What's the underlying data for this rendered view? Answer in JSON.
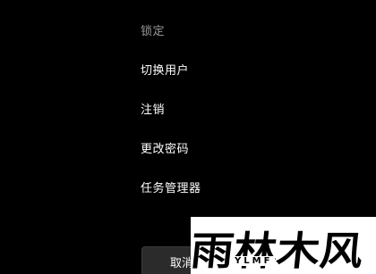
{
  "menu": {
    "items": [
      {
        "label": "锁定",
        "muted": true
      },
      {
        "label": "切换用户",
        "muted": false
      },
      {
        "label": "注销",
        "muted": false
      },
      {
        "label": "更改密码",
        "muted": false
      },
      {
        "label": "任务管理器",
        "muted": false
      }
    ]
  },
  "cancel_button": {
    "label": "取消"
  },
  "watermark": {
    "logo_text": "雨林木风",
    "sub_text": "YLMF"
  },
  "colors": {
    "background": "#000000",
    "text": "#ffffff",
    "muted_text": "#9a9a9a",
    "button_bg": "#2b2b2b"
  }
}
